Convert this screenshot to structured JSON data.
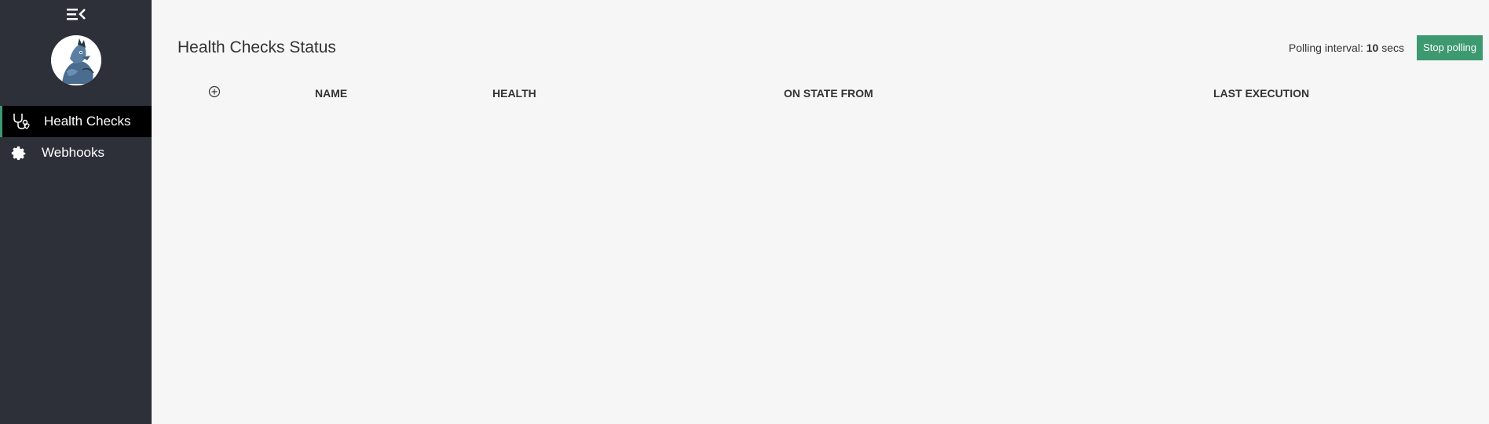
{
  "sidebar": {
    "items": [
      {
        "label": "Health Checks",
        "icon": "stethoscope-icon"
      },
      {
        "label": "Webhooks",
        "icon": "gear-icon"
      }
    ]
  },
  "header": {
    "title": "Health Checks Status",
    "polling_label": "Polling interval:",
    "polling_value": "10",
    "polling_unit": "secs",
    "stop_label": "Stop polling"
  },
  "table": {
    "columns": [
      "NAME",
      "HEALTH",
      "ON STATE FROM",
      "LAST EXECUTION"
    ]
  },
  "colors": {
    "sidebar_bg": "#2d3039",
    "accent": "#3d9970",
    "content_bg": "#f6f6f6"
  }
}
